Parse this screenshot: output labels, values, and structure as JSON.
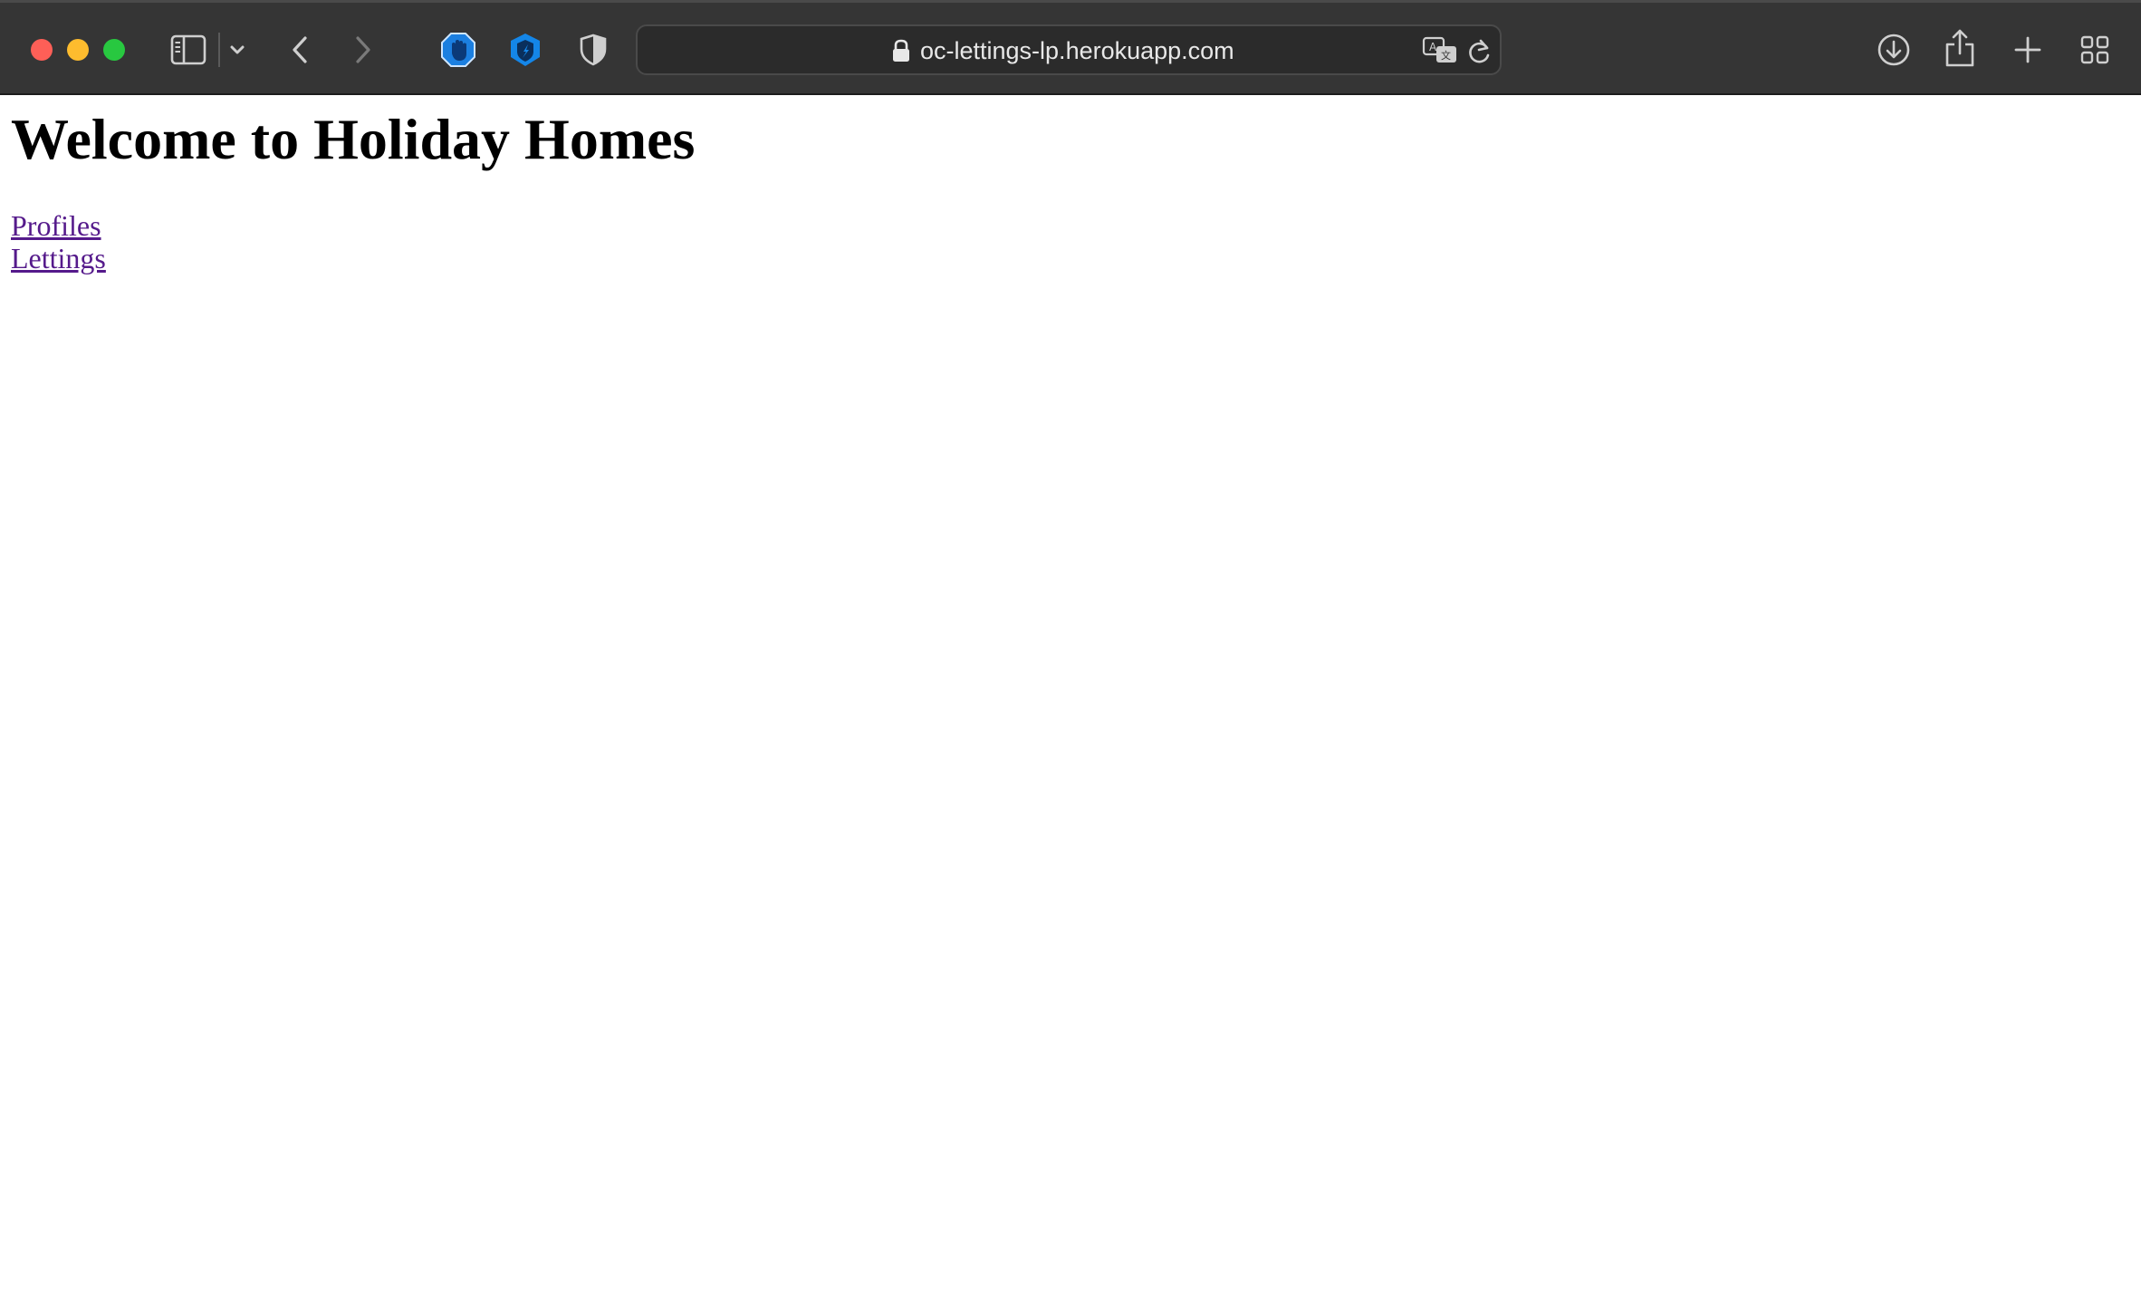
{
  "browser": {
    "address_bar": {
      "url": "oc-lettings-lp.herokuapp.com"
    },
    "icons": {
      "sidebar": "sidebar-icon",
      "sidebar_menu": "chevron-down-icon",
      "back": "chevron-left-icon",
      "forward": "chevron-right-icon",
      "extension_1": "hand-stop-icon",
      "extension_2": "shield-check-icon",
      "extension_3": "shield-half-icon",
      "secure": "lock-icon",
      "translate": "translate-icon",
      "reload": "reload-icon",
      "downloads": "download-icon",
      "share": "share-icon",
      "new_tab": "plus-icon",
      "tab_overview": "grid-icon"
    },
    "colors": {
      "toolbar": "#353535",
      "close": "#fe5f57",
      "minimize": "#febc2e",
      "zoom": "#28c840"
    }
  },
  "page": {
    "title": "Welcome to Holiday Homes",
    "links": [
      {
        "label": "Profiles"
      },
      {
        "label": "Lettings"
      }
    ],
    "colors": {
      "visited_link": "#551a8b"
    }
  }
}
